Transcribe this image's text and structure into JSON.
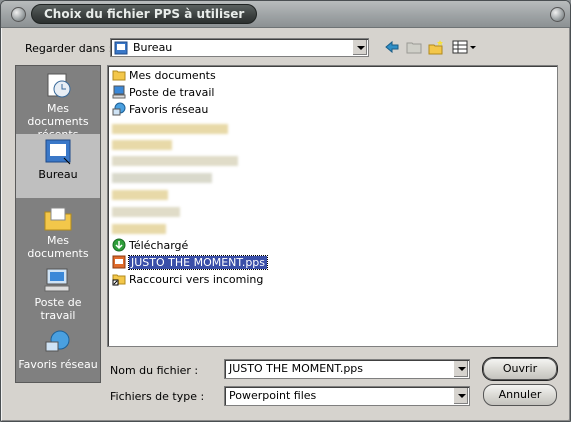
{
  "window": {
    "title": "Choix du fichier PPS à utiliser"
  },
  "lookin": {
    "label": "Regarder dans :",
    "value": "Bureau"
  },
  "toolbar": {
    "icons": [
      "back-arrow-icon",
      "up-folder-icon",
      "new-folder-icon",
      "view-menu-icon"
    ]
  },
  "places": [
    {
      "label": "Mes documents récents",
      "icon": "recent-documents-icon"
    },
    {
      "label": "Bureau",
      "icon": "desktop-icon"
    },
    {
      "label": "Mes documents",
      "icon": "my-documents-icon"
    },
    {
      "label": "Poste de travail",
      "icon": "computer-icon"
    },
    {
      "label": "Favoris réseau",
      "icon": "network-icon"
    }
  ],
  "files": [
    {
      "name": "Mes documents",
      "icon": "documents-folder-icon"
    },
    {
      "name": "Poste de travail",
      "icon": "computer-icon"
    },
    {
      "name": "Favoris réseau",
      "icon": "network-icon"
    },
    {
      "name": "Téléchargé",
      "icon": "download-icon"
    },
    {
      "name": "JUSTO THE MOMENT.pps",
      "icon": "pps-file-icon",
      "selected": true
    },
    {
      "name": "Raccourci vers incoming",
      "icon": "shortcut-folder-icon"
    }
  ],
  "filename": {
    "label": "Nom du fichier :",
    "value": "JUSTO THE MOMENT.pps"
  },
  "filetype": {
    "label": "Fichiers de type :",
    "value": "Powerpoint files"
  },
  "buttons": {
    "open": "Ouvrir",
    "cancel": "Annuler"
  },
  "colors": {
    "selection": "#3a4fa8",
    "places_bg": "#808080",
    "dialog_bg": "#d6d3ce"
  }
}
